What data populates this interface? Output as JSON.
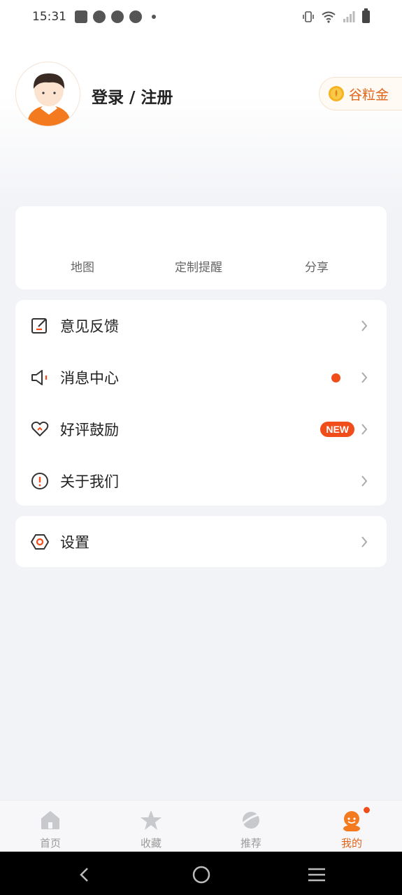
{
  "status_bar": {
    "time": "15:31"
  },
  "profile": {
    "login_label": "登录 / 注册",
    "coin_label": "谷粒金"
  },
  "tools": [
    {
      "label": "地图",
      "icon": "map-icon"
    },
    {
      "label": "定制提醒",
      "icon": "reminder-icon"
    },
    {
      "label": "分享",
      "icon": "share-icon"
    }
  ],
  "menu": {
    "feedback": "意见反馈",
    "messages": "消息中心",
    "rate": "好评鼓励",
    "rate_badge": "NEW",
    "about": "关于我们",
    "settings": "设置"
  },
  "tabs": [
    {
      "label": "首页",
      "icon": "home-icon"
    },
    {
      "label": "收藏",
      "icon": "star-icon"
    },
    {
      "label": "推荐",
      "icon": "planet-icon"
    },
    {
      "label": "我的",
      "icon": "profile-icon",
      "active": true
    }
  ],
  "colors": {
    "accent": "#e0651a",
    "badge": "#f04d1a",
    "background": "#f2f3f7"
  }
}
